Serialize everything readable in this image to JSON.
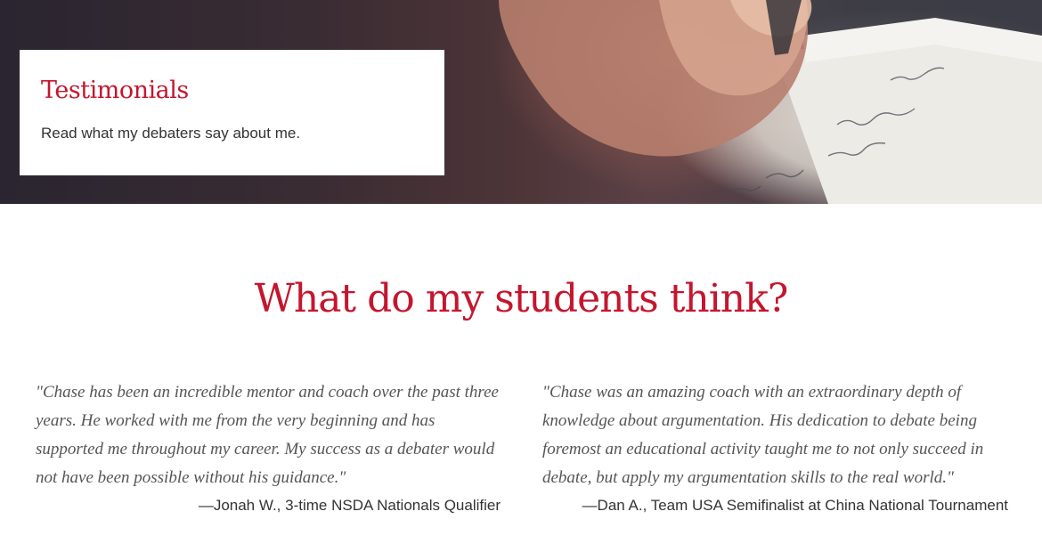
{
  "hero": {
    "title": "Testimonials",
    "subtitle": "Read what my debaters say about me."
  },
  "section": {
    "title": "What do my students think?"
  },
  "testimonials": [
    {
      "quote": "\"Chase has been an incredible mentor and coach over the past three years. He worked with me from the very beginning and has supported me throughout my career. My success as a debater would not have been possible without his guidance.\"",
      "attribution": "—Jonah W., 3-time NSDA Nationals Qualifier"
    },
    {
      "quote": "\"Chase was an amazing coach with an extraordinary depth of knowledge about argumentation. His dedication to debate being foremost an educational activity taught me to not only succeed in debate, but apply my argumentation skills to the real world.\"",
      "attribution": "—Dan A., Team USA Semifinalist at China National Tournament"
    }
  ],
  "colors": {
    "accent": "#c4162e",
    "body_text": "#333333",
    "quote_text": "#555555"
  }
}
